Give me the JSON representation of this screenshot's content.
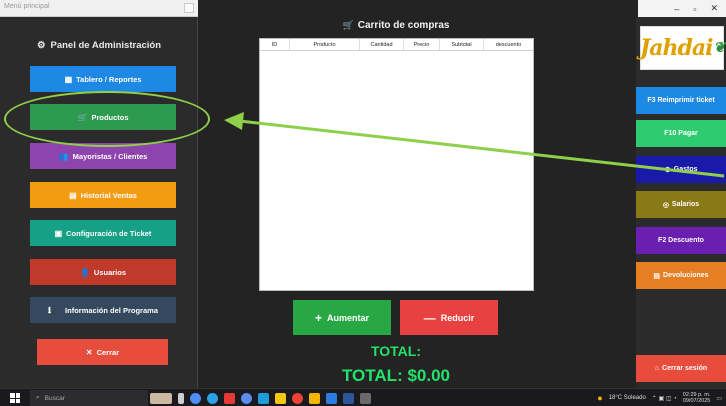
{
  "menu_window": {
    "title": "Menú principal",
    "heading": "Panel de Administración",
    "buttons": [
      {
        "label": "Tablero / Reportes",
        "icon": "chart-icon",
        "color": "#1e88e5"
      },
      {
        "label": "Productos",
        "icon": "cart-icon",
        "color": "#2e9a4f"
      },
      {
        "label": "Mayoristas / Clientes",
        "icon": "people-icon",
        "color": "#8e44ad"
      },
      {
        "label": "Historial Ventas",
        "icon": "receipt-icon",
        "color": "#f39c12"
      },
      {
        "label": "Configuración de Ticket",
        "icon": "ticket-icon",
        "color": "#16a085"
      },
      {
        "label": "Usuarios",
        "icon": "user-icon",
        "color": "#c0392b"
      },
      {
        "label": "Información del Programa",
        "icon": "info-icon",
        "color": "#34495e"
      },
      {
        "label": "Cerrar",
        "icon": "close-icon",
        "color": "#e74c3c"
      }
    ]
  },
  "cart": {
    "title": "Carrito de compras",
    "columns": [
      "ID",
      "Producto",
      "Cantidad",
      "Precio",
      "Subtotal",
      "descuento"
    ],
    "add_label": "Aumentar",
    "reduce_label": "Reducir",
    "total_label": "TOTAL:",
    "total_value": "TOTAL: $0.00"
  },
  "logo_text": "Jahdai",
  "right_buttons": [
    {
      "label": "F3 Reimprimir ticket",
      "color": "#1e88e5"
    },
    {
      "label": "F10 Pagar",
      "color": "#2ecc71"
    },
    {
      "label": "Gastos",
      "icon": "gear-icon",
      "color": "#1a1aa8"
    },
    {
      "label": "Salarios",
      "icon": "money-icon",
      "color": "#8a7a17"
    },
    {
      "label": "F2 Descuento",
      "color": "#6a1fb0"
    },
    {
      "label": "Devoluciones",
      "icon": "return-icon",
      "color": "#e67e22"
    },
    {
      "label": "Cerrar sesión",
      "icon": "door-icon",
      "color": "#e74c3c"
    }
  ],
  "taskbar": {
    "search_placeholder": "Buscar",
    "weather": "18°C Soleado",
    "time": "02:29 p. m.",
    "date": "09/07/2025"
  }
}
